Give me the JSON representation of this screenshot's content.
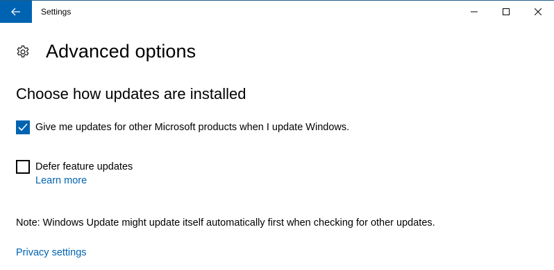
{
  "window": {
    "title": "Settings",
    "accent": "#0063b1"
  },
  "header": {
    "icon": "gear-icon",
    "title": "Advanced options"
  },
  "section": {
    "title": "Choose how updates are installed"
  },
  "options": [
    {
      "label": "Give me updates for other Microsoft products when I update Windows.",
      "checked": true
    },
    {
      "label": "Defer feature updates",
      "checked": false
    }
  ],
  "links": {
    "learn_more": "Learn more",
    "privacy": "Privacy settings"
  },
  "note": "Note: Windows Update might update itself automatically first when checking for other updates."
}
